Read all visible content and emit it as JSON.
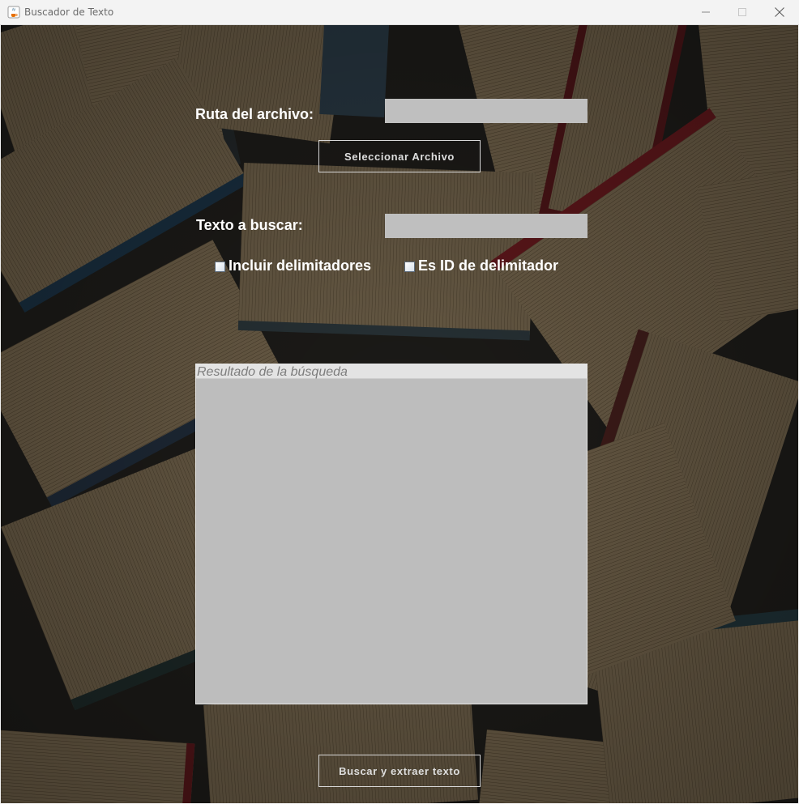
{
  "window": {
    "title": "Buscador de Texto",
    "icon": "java-cup-icon"
  },
  "form": {
    "file_path_label": "Ruta del archivo:",
    "file_path_value": "",
    "select_file_button": "Seleccionar Archivo",
    "search_text_label": "Texto a buscar:",
    "search_text_value": "",
    "include_delimiters_label": "Incluir delimitadores",
    "include_delimiters_checked": false,
    "is_delimiter_id_label": "Es ID de delimitador",
    "is_delimiter_id_checked": false,
    "result_placeholder": "Resultado de la búsqueda",
    "search_extract_button": "Buscar y extraer texto"
  },
  "colors": {
    "field_background": "#bfbfbf",
    "label_text": "#ffffff",
    "button_text": "#dedede"
  }
}
